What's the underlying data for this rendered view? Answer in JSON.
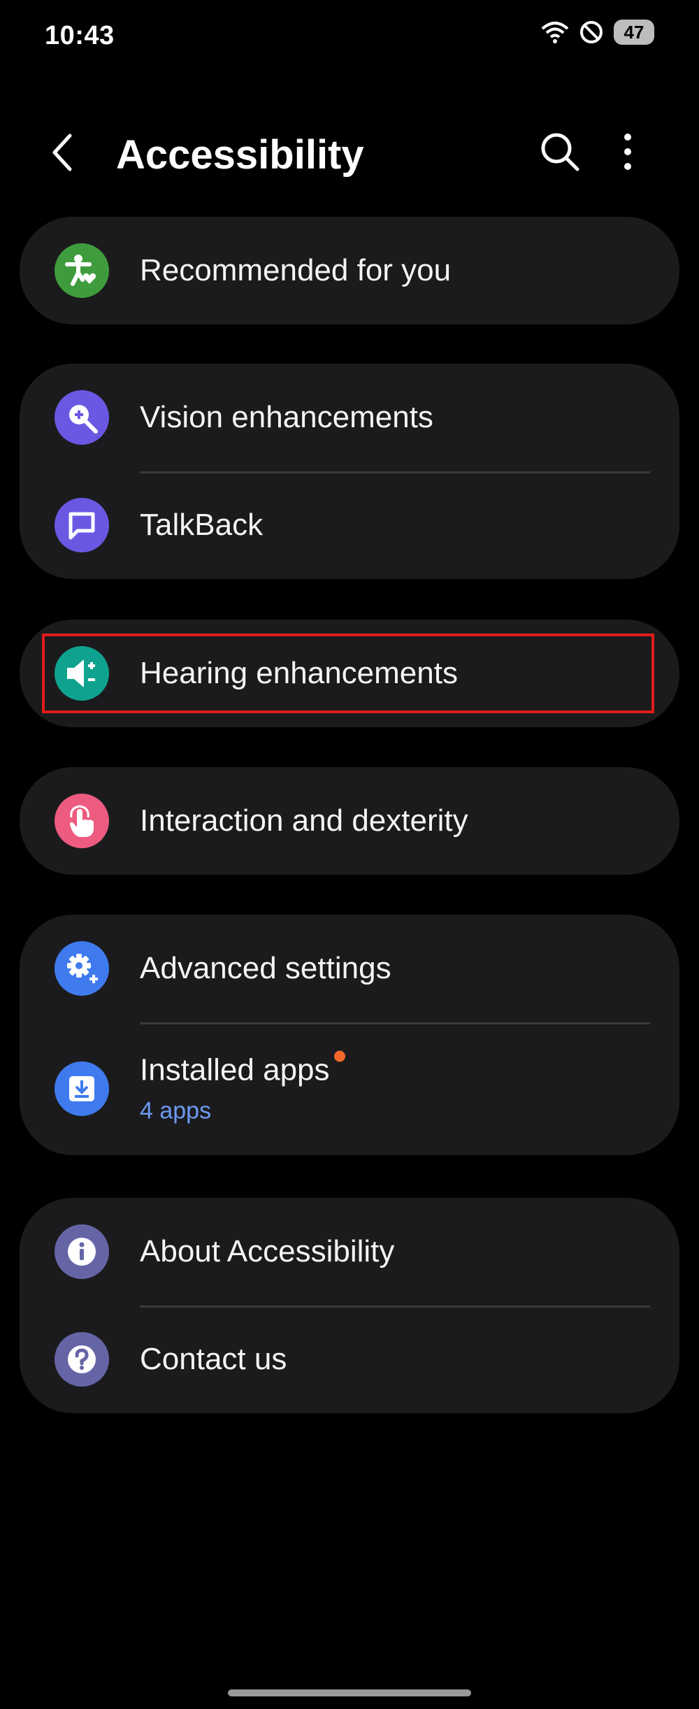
{
  "status_bar": {
    "time": "10:43",
    "battery": "47"
  },
  "app_bar": {
    "title": "Accessibility"
  },
  "menu": {
    "recommended": {
      "label": "Recommended for you",
      "color": "#3f9c3d"
    },
    "vision": {
      "label": "Vision enhancements",
      "color": "#6a58e3"
    },
    "talkback": {
      "label": "TalkBack",
      "color": "#6a58e3"
    },
    "hearing": {
      "label": "Hearing enhancements",
      "color": "#0fa28f"
    },
    "interaction": {
      "label": "Interaction and dexterity",
      "color": "#ee5b80"
    },
    "advanced": {
      "label": "Advanced settings",
      "color": "#3f7bef"
    },
    "installed": {
      "label": "Installed apps",
      "sub": "4 apps",
      "color": "#3f7bef"
    },
    "about": {
      "label": "About Accessibility",
      "color": "#6565a6"
    },
    "contact": {
      "label": "Contact us",
      "color": "#6565a6"
    }
  }
}
